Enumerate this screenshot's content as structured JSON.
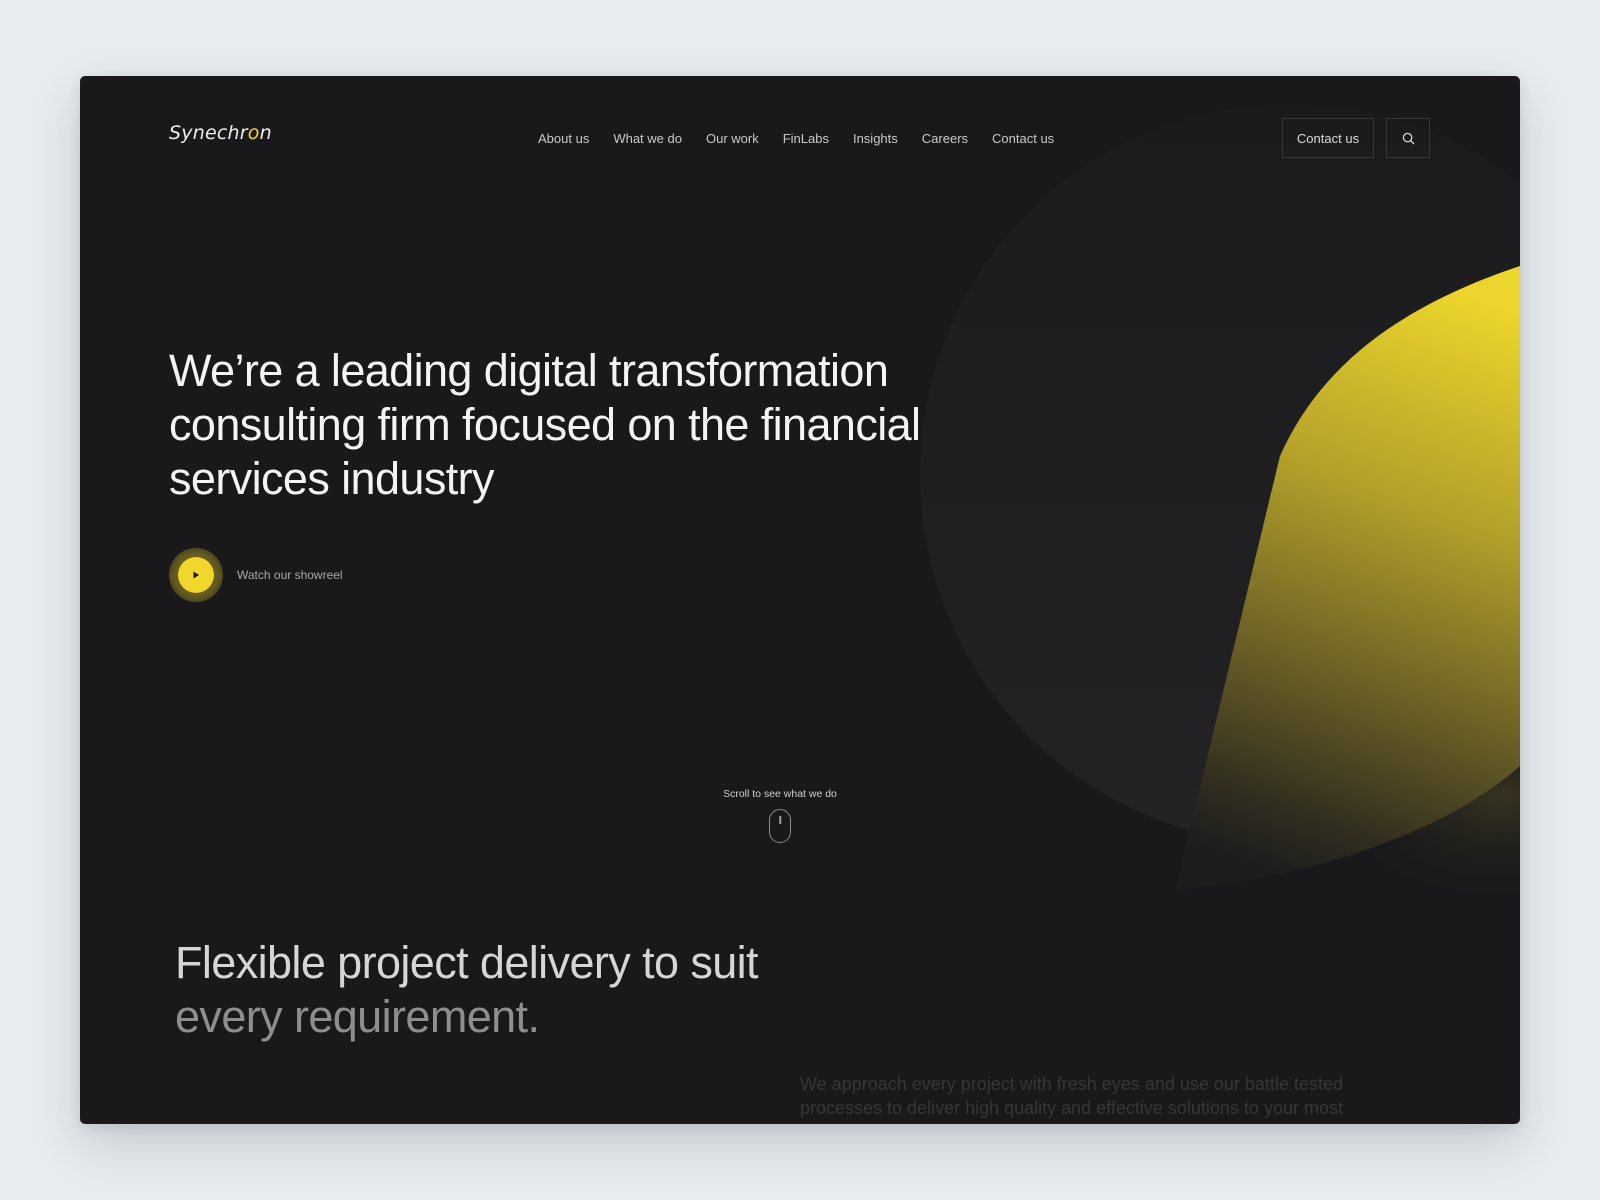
{
  "brand": {
    "logo_text_main": "Synechr",
    "logo_text_accent": "o",
    "logo_text_end": "n",
    "accent_color": "#f1d72b",
    "background_color": "#19191b"
  },
  "nav": {
    "items": [
      {
        "label": "About us"
      },
      {
        "label": "What we do"
      },
      {
        "label": "Our work"
      },
      {
        "label": "FinLabs"
      },
      {
        "label": "Insights"
      },
      {
        "label": "Careers"
      },
      {
        "label": "Contact us"
      }
    ]
  },
  "header": {
    "contact_button_label": "Contact us",
    "search_icon": "search-icon"
  },
  "hero": {
    "title": "We’re a leading digital transformation consulting firm focused on the financial services industry",
    "showreel_label": "Watch our showreel",
    "play_icon": "play-icon"
  },
  "scroll_hint": {
    "label": "Scroll to see what we do",
    "icon": "mouse-icon"
  },
  "section": {
    "title_line1": "Flexible project delivery to suit",
    "title_line2": "every requirement.",
    "body": "We approach every project with fresh eyes and use our battle tested processes to deliver high quality and effective solutions to your most"
  }
}
